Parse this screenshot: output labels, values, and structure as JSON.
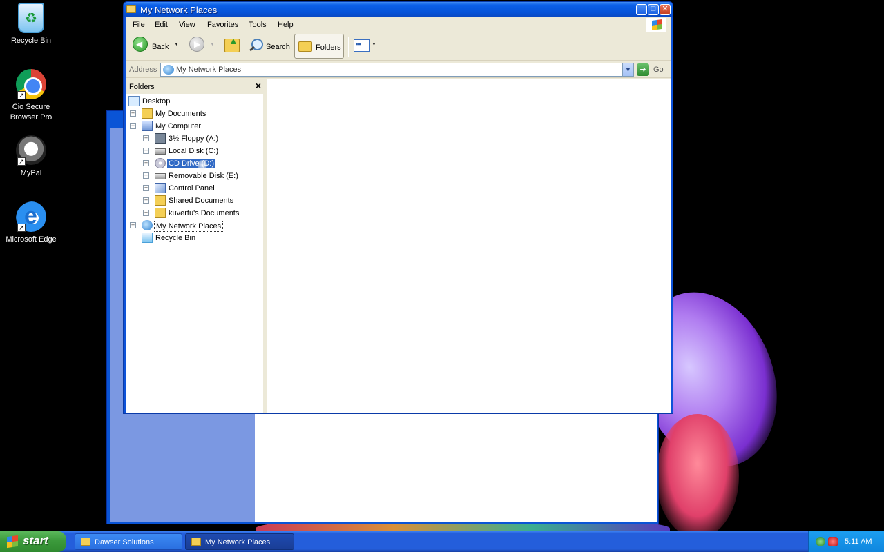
{
  "desktop": {
    "icons": [
      {
        "label": "Recycle Bin",
        "icon": "recycle-bin-icon"
      },
      {
        "label": "Cio Secure Browser Pro",
        "icon": "chrome-icon"
      },
      {
        "label": "MyPal",
        "icon": "raccoon-icon"
      },
      {
        "label": "Microsoft Edge",
        "icon": "edge-icon"
      }
    ]
  },
  "window": {
    "title": "My Network Places",
    "controls": {
      "minimize": "_",
      "maximize": "□",
      "close": "✕"
    },
    "menu": [
      {
        "label": "File"
      },
      {
        "label": "Edit"
      },
      {
        "label": "View"
      },
      {
        "label": "Favorites"
      },
      {
        "label": "Tools"
      },
      {
        "label": "Help"
      }
    ],
    "toolbar": {
      "back_label": "Back",
      "search_label": "Search",
      "folders_label": "Folders"
    },
    "address": {
      "label": "Address",
      "value": "My Network Places",
      "go_label": "Go"
    },
    "folders_pane": {
      "title": "Folders",
      "close": "×",
      "tree": [
        {
          "label": "Desktop",
          "icon": "desktop-icon"
        },
        {
          "label": "My Documents",
          "icon": "my-documents-icon",
          "expander": "+"
        },
        {
          "label": "My Computer",
          "icon": "my-computer-icon",
          "expander": "−"
        },
        {
          "label": "3½ Floppy (A:)",
          "icon": "floppy-icon",
          "expander": "+"
        },
        {
          "label": "Local Disk (C:)",
          "icon": "local-disk-icon",
          "expander": "+"
        },
        {
          "label": "CD Drive (D:)",
          "icon": "cd-drive-icon",
          "expander": "+",
          "selected": true
        },
        {
          "label": "Removable Disk (E:)",
          "icon": "removable-disk-icon",
          "expander": "+"
        },
        {
          "label": "Control Panel",
          "icon": "control-panel-icon",
          "expander": "+"
        },
        {
          "label": "Shared Documents",
          "icon": "folder-icon",
          "expander": "+"
        },
        {
          "label": "kuvertu's Documents",
          "icon": "folder-icon",
          "expander": "+"
        },
        {
          "label": "My Network Places",
          "icon": "network-places-icon",
          "expander": "+",
          "focused": true
        },
        {
          "label": "Recycle Bin",
          "icon": "recycle-bin-icon"
        }
      ]
    }
  },
  "taskbar": {
    "start_label": "start",
    "tasks": [
      {
        "label": "Dawser Solutions"
      },
      {
        "label": "My Network Places",
        "active": true
      }
    ],
    "clock": "5:11 AM"
  }
}
